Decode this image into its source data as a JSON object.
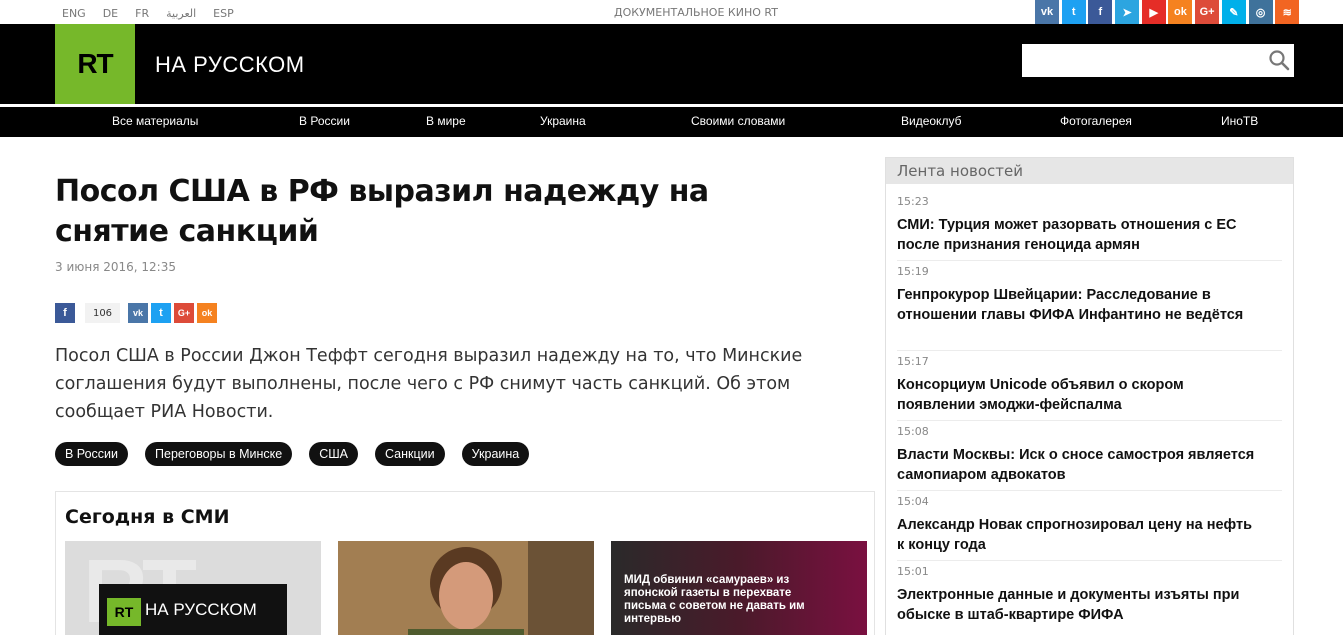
{
  "top": {
    "languages": [
      "ENG",
      "DE",
      "FR",
      "العربية",
      "ESP"
    ],
    "doc_link": "ДОКУМЕНТАЛЬНОЕ КИНО RT",
    "socials": [
      {
        "icon": "vk-icon",
        "glyph": "vk",
        "color": "#4a76a8"
      },
      {
        "icon": "twitter-icon",
        "glyph": "t",
        "color": "#1da1f2"
      },
      {
        "icon": "facebook-icon",
        "glyph": "f",
        "color": "#3b5998"
      },
      {
        "icon": "telegram-icon",
        "glyph": "➤",
        "color": "#2ca5e0"
      },
      {
        "icon": "youtube-icon",
        "glyph": "▶",
        "color": "#e52d27"
      },
      {
        "icon": "odnoklassniki-icon",
        "glyph": "ok",
        "color": "#f58220"
      },
      {
        "icon": "google-plus-icon",
        "glyph": "G+",
        "color": "#dd4b39"
      },
      {
        "icon": "livejournal-icon",
        "glyph": "✎",
        "color": "#00b0ea"
      },
      {
        "icon": "instagram-icon",
        "glyph": "◎",
        "color": "#3f729b"
      },
      {
        "icon": "rss-icon",
        "glyph": "≋",
        "color": "#f26522"
      }
    ]
  },
  "header": {
    "logo_text": "RT",
    "site_name": "НА РУССКОМ",
    "search_placeholder": ""
  },
  "nav": {
    "items": [
      "Все материалы",
      "В России",
      "В мире",
      "Украина",
      "Своими словами",
      "Видеоклуб",
      "Фотогалерея",
      "ИноТВ"
    ]
  },
  "article": {
    "title": "Посол США в РФ выразил надежду на снятие санкций",
    "date": "3 июня 2016, 12:35",
    "share_count": "106",
    "lead": "Посол США в России Джон Теффт сегодня выразил надежду на то, что Минские соглашения будут выполнены, после чего с РФ снимут часть санкций. Об этом сообщает РИА Новости.",
    "tags": [
      "В России",
      "Переговоры в Минске",
      "США",
      "Санкции",
      "Украина"
    ]
  },
  "smi": {
    "title": "Сегодня в СМИ",
    "card1": {
      "logo": "RT",
      "name": "НА РУССКОМ"
    },
    "card3_text": "МИД обвинил «самураев» из японской газеты в перехвате письма с советом не давать им интервью"
  },
  "sidebar": {
    "title": "Лента новостей",
    "news": [
      {
        "time": "15:23",
        "headline": "СМИ: Турция может разорвать отношения с ЕС после признания геноцида армян"
      },
      {
        "time": "15:19",
        "headline": "Генпрокурор Швейцарии: Расследование в отношении главы ФИФА Инфантино не ведётся"
      },
      {
        "time": "15:17",
        "headline": "Консорциум Unicode объявил о скором появлении эмоджи-фейспалма"
      },
      {
        "time": "15:08",
        "headline": "Власти Москвы: Иск о сносе самостроя является самопиаром адвокатов"
      },
      {
        "time": "15:04",
        "headline": "Александр Новак спрогнозировал цену на нефть к концу года"
      },
      {
        "time": "15:01",
        "headline": "Электронные данные и документы изъяты при обыске в штаб-квартире ФИФА"
      }
    ]
  },
  "colors": {
    "brand_green": "#76b82a",
    "header_bg": "#000000"
  }
}
